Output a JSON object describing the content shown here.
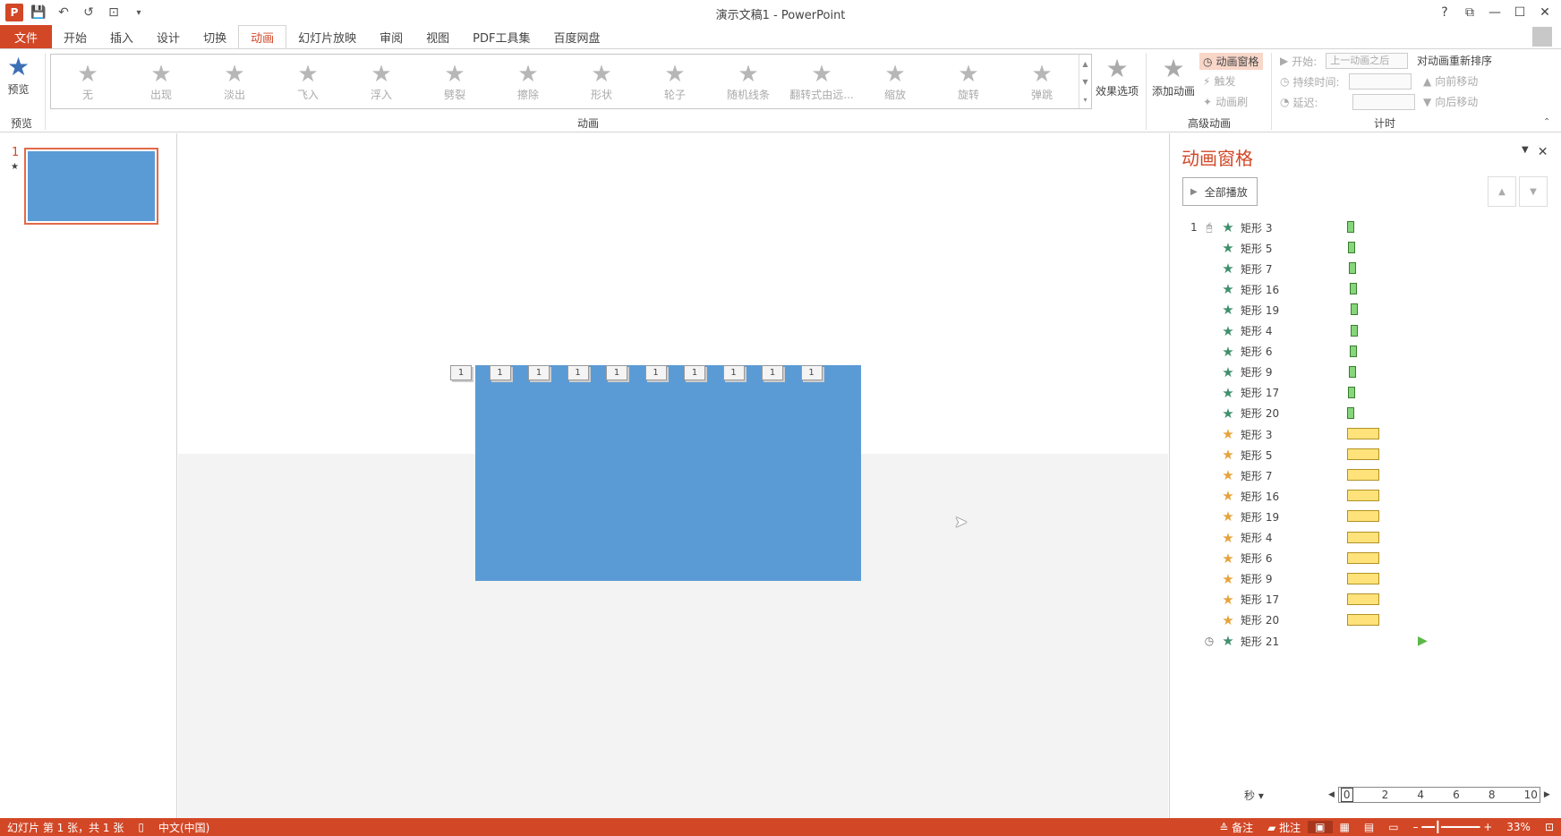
{
  "window": {
    "title": "演示文稿1 - PowerPoint",
    "help": "?",
    "min": "—",
    "max": "☐",
    "close": "✕"
  },
  "qat": {
    "logo": "P",
    "save": "💾",
    "undo": "↶",
    "redo": "↺",
    "present": "⊡",
    "more": "▾"
  },
  "tabs": [
    "文件",
    "开始",
    "插入",
    "设计",
    "切换",
    "动画",
    "幻灯片放映",
    "审阅",
    "视图",
    "PDF工具集",
    "百度网盘"
  ],
  "active_tab": "动画",
  "ribbon": {
    "preview": {
      "label": "预览",
      "group": "预览"
    },
    "gallery": {
      "group": "动画",
      "items": [
        "无",
        "出现",
        "淡出",
        "飞入",
        "浮入",
        "劈裂",
        "擦除",
        "形状",
        "轮子",
        "随机线条",
        "翻转式由远...",
        "缩放",
        "旋转",
        "弹跳"
      ]
    },
    "effect_options": "效果选项",
    "add_animation": "添加动画",
    "anim_pane_btn": "动画窗格",
    "trigger": "触发",
    "anim_painter": "动画刷",
    "advanced_group": "高级动画",
    "start_label": "开始:",
    "start_value": "上一动画之后",
    "duration_label": "持续时间:",
    "delay_label": "延迟:",
    "timing_group": "计时",
    "reorder": "对动画重新排序",
    "move_earlier": "向前移动",
    "move_later": "向后移动"
  },
  "thumbnail": {
    "number": "1",
    "marker": "★"
  },
  "slide_tags": [
    "1",
    "1",
    "1",
    "1",
    "1",
    "1",
    "1",
    "1",
    "1",
    "1"
  ],
  "anim_pane": {
    "title": "动画窗格",
    "play_all": "全部播放",
    "sequence_number": "1",
    "items": [
      {
        "name": "矩形 3",
        "type": "entrance",
        "start": 0.1,
        "dur": 0.2
      },
      {
        "name": "矩形 5",
        "type": "entrance",
        "start": 0.15,
        "dur": 0.2
      },
      {
        "name": "矩形 7",
        "type": "entrance",
        "start": 0.2,
        "dur": 0.2
      },
      {
        "name": "矩形 16",
        "type": "entrance",
        "start": 0.25,
        "dur": 0.2
      },
      {
        "name": "矩形 19",
        "type": "entrance",
        "start": 0.3,
        "dur": 0.2
      },
      {
        "name": "矩形 4",
        "type": "entrance",
        "start": 0.3,
        "dur": 0.2
      },
      {
        "name": "矩形 6",
        "type": "entrance",
        "start": 0.25,
        "dur": 0.2
      },
      {
        "name": "矩形 9",
        "type": "entrance",
        "start": 0.2,
        "dur": 0.2
      },
      {
        "name": "矩形 17",
        "type": "entrance",
        "start": 0.15,
        "dur": 0.2
      },
      {
        "name": "矩形 20",
        "type": "entrance",
        "start": 0.1,
        "dur": 0.2
      },
      {
        "name": "矩形 3",
        "type": "emphasis",
        "start": 0.1,
        "dur": 1.8
      },
      {
        "name": "矩形 5",
        "type": "emphasis",
        "start": 0.1,
        "dur": 1.8
      },
      {
        "name": "矩形 7",
        "type": "emphasis",
        "start": 0.1,
        "dur": 1.8
      },
      {
        "name": "矩形 16",
        "type": "emphasis",
        "start": 0.1,
        "dur": 1.8
      },
      {
        "name": "矩形 19",
        "type": "emphasis",
        "start": 0.1,
        "dur": 1.8
      },
      {
        "name": "矩形 4",
        "type": "emphasis",
        "start": 0.1,
        "dur": 1.8
      },
      {
        "name": "矩形 6",
        "type": "emphasis",
        "start": 0.1,
        "dur": 1.8
      },
      {
        "name": "矩形 9",
        "type": "emphasis",
        "start": 0.1,
        "dur": 1.8
      },
      {
        "name": "矩形 17",
        "type": "emphasis",
        "start": 0.1,
        "dur": 1.8
      },
      {
        "name": "矩形 20",
        "type": "emphasis",
        "start": 0.1,
        "dur": 1.8
      },
      {
        "name": "矩形 21",
        "type": "after",
        "start": 2.0,
        "dur": 0
      }
    ],
    "timeline": {
      "unit": "秒",
      "ticks": [
        "0",
        "2",
        "4",
        "6",
        "8",
        "10"
      ]
    }
  },
  "status": {
    "slide_info": "幻灯片 第 1 张，共 1 张",
    "language": "中文(中国)",
    "notes": "备注",
    "comments": "批注",
    "zoom": "33%"
  },
  "colors": {
    "accent": "#d24726",
    "slide": "#5b9bd5",
    "entrance": "#86d67c",
    "emphasis": "#ffe27a",
    "entrance_star": "#3f8f6c",
    "emphasis_star": "#e6a33c"
  }
}
